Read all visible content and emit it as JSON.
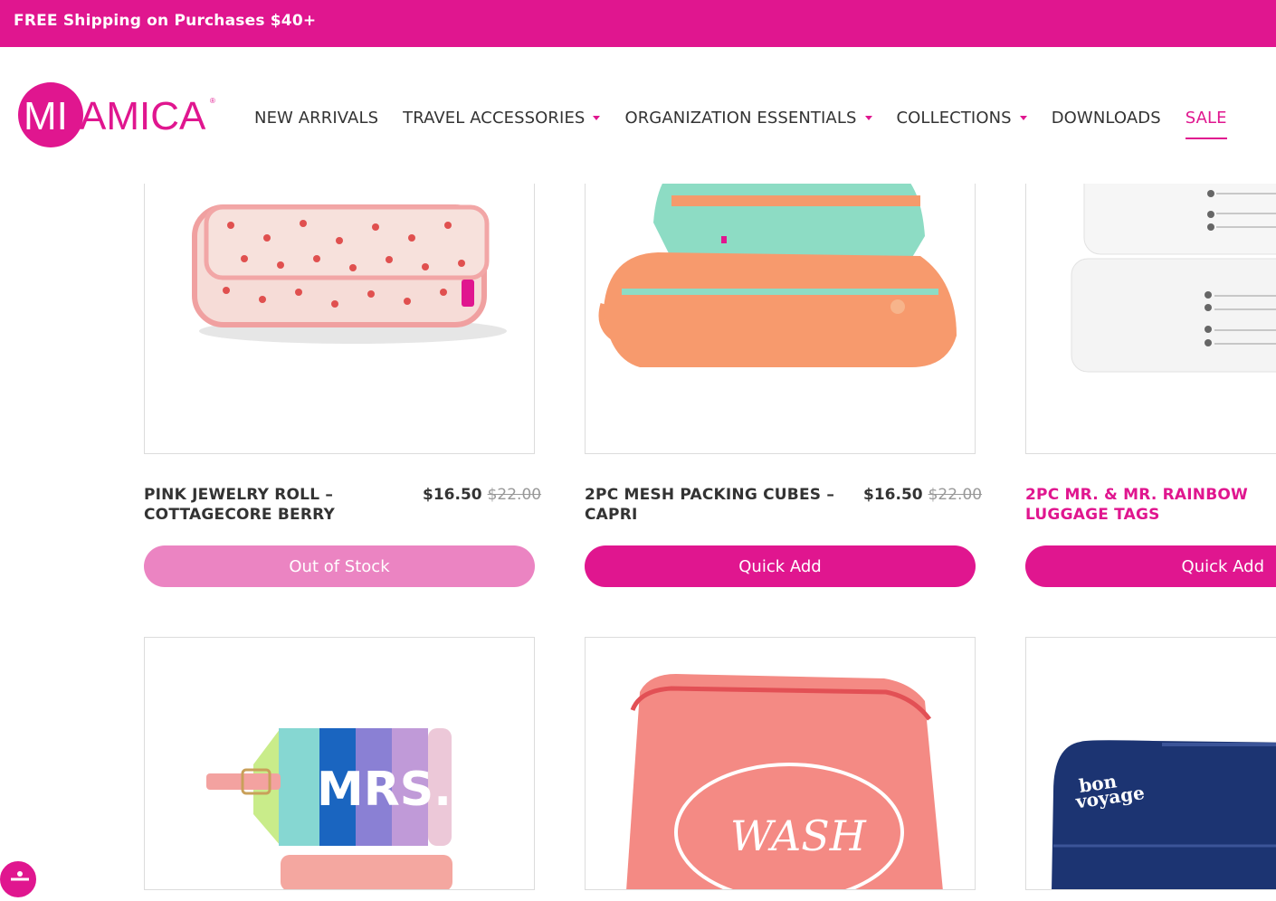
{
  "promo": {
    "text": "FREE Shipping on Purchases $40+"
  },
  "brand": {
    "name": "MIAMICA",
    "accent": "#e0168f"
  },
  "nav": {
    "items": [
      {
        "label": "NEW ARRIVALS",
        "dropdown": false
      },
      {
        "label": "TRAVEL ACCESSORIES",
        "dropdown": true
      },
      {
        "label": "ORGANIZATION ESSENTIALS",
        "dropdown": true
      },
      {
        "label": "COLLECTIONS",
        "dropdown": true
      },
      {
        "label": "DOWNLOADS",
        "dropdown": false
      },
      {
        "label": "SALE",
        "dropdown": false,
        "active": true
      }
    ]
  },
  "products": [
    {
      "title_line1": "PINK JEWELRY ROLL –",
      "title_line2": "COTTAGECORE BERRY",
      "price": "$16.50",
      "old_price": "$22.00",
      "button": "Out of Stock"
    },
    {
      "title_line1": "2PC MESH PACKING CUBES –",
      "title_line2": "CAPRI",
      "price": "$16.50",
      "old_price": "$22.00",
      "button": "Quick Add"
    },
    {
      "title_line1": "2PC MR. & MR. RAINBOW",
      "title_line2": "LUGGAGE TAGS",
      "price": "",
      "old_price": "",
      "button": "Quick Add"
    }
  ],
  "images": {
    "mrs_tag_text": "MRS.",
    "wash_bag_text": "WASH",
    "navy_bag_text_1": "bon",
    "navy_bag_text_2": "voyage"
  }
}
